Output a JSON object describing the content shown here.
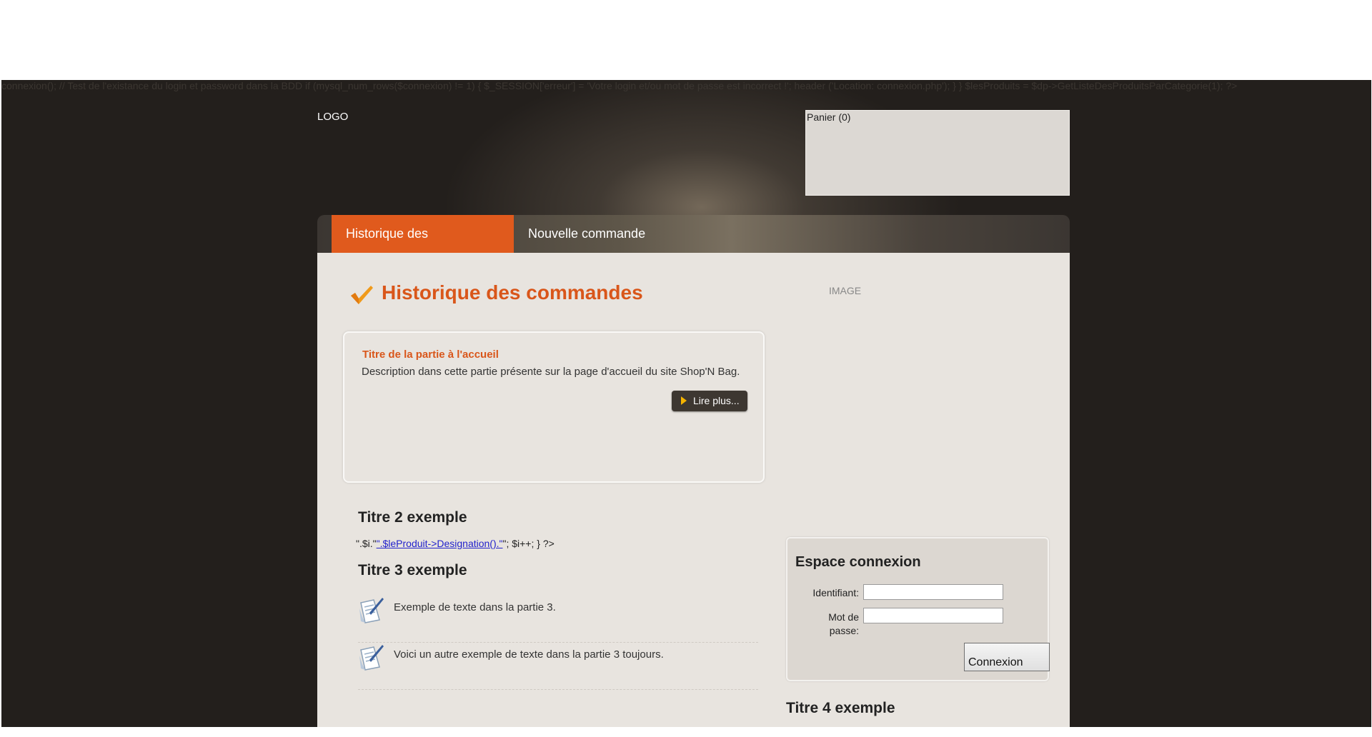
{
  "php_leak": "connexion(); // Test de l'existance du login et password dans la BDD if (mysql_num_rows($connexion) != 1) { $_SESSION['erreur'] = 'Votre login et/ou mot de passe est incorrect !'; header ('Location: connexion.php'); } } $lesProduits = $dp->GetListeDesProduitsParCategorie(1); ?>",
  "header": {
    "logo": "LOGO",
    "cart": "Panier (0)"
  },
  "nav": {
    "tabs": [
      {
        "label": "Historique des commandes",
        "active": true
      },
      {
        "label": "Nouvelle commande",
        "active": false
      }
    ]
  },
  "main": {
    "page_title": "Historique des commandes",
    "image_placeholder": "IMAGE",
    "info_box": {
      "title": "Titre de la partie à l'accueil",
      "description": "Description dans cette partie présente sur la page d'accueil du site Shop'N Bag.",
      "read_more": "Lire plus..."
    },
    "section2": {
      "title": "Titre 2 exemple",
      "prefix": "\".$i.\"",
      "link": "\".$leProduit->Designation().\"",
      "suffix": "\"; $i++; } ?>"
    },
    "section3": {
      "title": "Titre 3 exemple",
      "items": [
        "Exemple de texte dans la partie 3.",
        "Voici un autre exemple de texte dans la partie 3 toujours."
      ]
    },
    "section4": {
      "title": "Titre 4 exemple"
    }
  },
  "login": {
    "title": "Espace connexion",
    "user_label": "Identifiant:",
    "pass_label": "Mot de passe:",
    "submit": "Connexion"
  },
  "colors": {
    "accent": "#e05a1d",
    "background": "#231f1c",
    "content": "#e8e4df"
  }
}
